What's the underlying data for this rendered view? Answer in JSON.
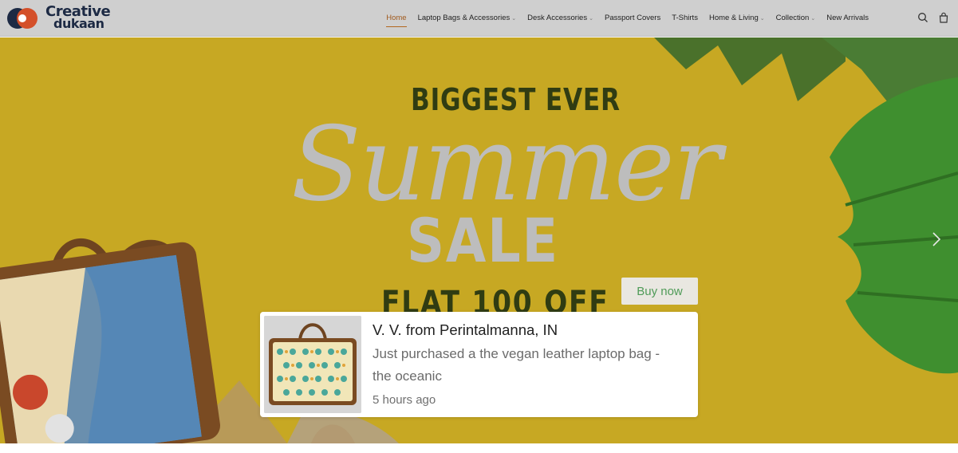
{
  "header": {
    "logo_line1": "Creative",
    "logo_line2": "dukaan",
    "nav": [
      {
        "label": "Home",
        "active": true,
        "has_dropdown": false
      },
      {
        "label": "Laptop Bags & Accessories",
        "active": false,
        "has_dropdown": true
      },
      {
        "label": "Desk Accessories",
        "active": false,
        "has_dropdown": true
      },
      {
        "label": "Passport Covers",
        "active": false,
        "has_dropdown": false
      },
      {
        "label": "T-Shirts",
        "active": false,
        "has_dropdown": false
      },
      {
        "label": "Home & Living",
        "active": false,
        "has_dropdown": true
      },
      {
        "label": "Collection",
        "active": false,
        "has_dropdown": true
      },
      {
        "label": "New Arrivals",
        "active": false,
        "has_dropdown": false
      }
    ],
    "icons": [
      "search-icon",
      "shopping-bag-icon"
    ]
  },
  "hero": {
    "line1": "BIGGEST EVER",
    "line2": "Summer",
    "line3": "SALE",
    "line4": "FLAT 100 OFF",
    "buy_label": "Buy now",
    "next_icon": "chevron-right-icon"
  },
  "popup": {
    "name": "V. V. from Perintalmanna, IN",
    "message": "Just purchased a the vegan leather laptop bag - the oceanic",
    "time": "5 hours ago"
  },
  "colors": {
    "header_bg": "#cfcfcf",
    "nav_active": "#a05a1c",
    "hero_bg": "#c4a522",
    "buy_text": "#4f9b58"
  }
}
